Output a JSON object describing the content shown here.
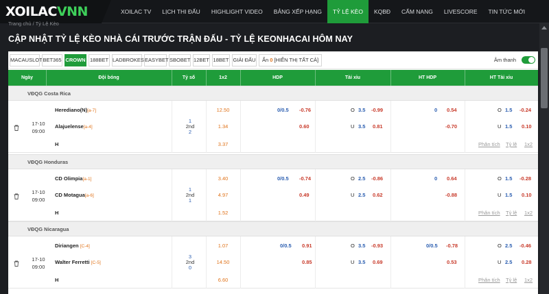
{
  "header": {
    "logo_white": "XOILAC",
    "logo_green": "VNN",
    "nav": [
      "XOILAC TV",
      "LỊCH THI ĐẤU",
      "HIGHLIGHT VIDEO",
      "BẢNG XẾP HẠNG",
      "TỶ LỆ KÈO",
      "KQBĐ",
      "CẨM NANG",
      "LIVESCORE",
      "TIN TỨC MỚI"
    ],
    "active_nav": "TỶ LỆ KÈO"
  },
  "breadcrumb": "Trang chủ / Tỷ Lệ Kèo",
  "page_title": "CẬP NHẬT TỶ LỆ KÈO NHÀ CÁI TRƯỚC TRẬN ĐẤU - TỶ LỆ KEONHACAI HÔM NAY",
  "bookmakers": [
    "MACAUSLOT",
    "BET365",
    "CROWN",
    "188BET",
    "LADBROKES",
    "EASYBET",
    "SBOBET",
    "12BET",
    "18BET",
    "GIẢI ĐẤU"
  ],
  "active_bookmaker": "CROWN",
  "hidden_prefix": "Ẩn",
  "hidden_count": "0",
  "show_all": "[HIỂN THỊ TẤT CẢ]",
  "sound_label": "Âm thanh",
  "columns": [
    "Ngày",
    "Đội bóng",
    "Tỷ số",
    "1x2",
    "HDP",
    "Tài xỉu",
    "HT HDP",
    "HT Tài xỉu"
  ],
  "links": [
    "Phân tích",
    "Tỷ lệ",
    "1x2"
  ],
  "leagues": [
    {
      "name": "VĐQG Costa Rica",
      "date": "17-10",
      "time": "09:00",
      "home": "Herediano(N)",
      "home_rank": "[a-7]",
      "away": "Alajuelense",
      "away_rank": "[a-4]",
      "draw": "H",
      "score_home": "1",
      "score_period": "2nd",
      "score_away": "2",
      "x12": [
        "12.50",
        "1.34",
        "3.37"
      ],
      "hdp_line": "0/0.5",
      "hdp_home": "-0.76",
      "hdp_away": "0.60",
      "ou_over": "O",
      "ou_line": "3.5",
      "ou_over_odds": "-0.99",
      "ou_under": "U",
      "ou_line_u": "3.5",
      "ou_under_odds": "0.81",
      "hthdp_line": "0",
      "hthdp_home": "0.54",
      "hthdp_away": "-0.70",
      "htou_over": "O",
      "htou_line": "1.5",
      "htou_over_odds": "-0.24",
      "htou_under": "U",
      "htou_line_u": "1.5",
      "htou_under_odds": "0.10"
    },
    {
      "name": "VĐQG Honduras",
      "date": "17-10",
      "time": "09:00",
      "home": "CD Olimpia",
      "home_rank": "[a-1]",
      "away": "CD Motagua",
      "away_rank": "[a-6]",
      "draw": "H",
      "score_home": "1",
      "score_period": "2nd",
      "score_away": "1",
      "x12": [
        "3.40",
        "4.97",
        "1.52"
      ],
      "hdp_line": "0/0.5",
      "hdp_home": "-0.74",
      "hdp_away": "0.49",
      "ou_over": "O",
      "ou_line": "2.5",
      "ou_over_odds": "-0.86",
      "ou_under": "U",
      "ou_line_u": "2.5",
      "ou_under_odds": "0.62",
      "hthdp_line": "0",
      "hthdp_home": "0.64",
      "hthdp_away": "-0.88",
      "htou_over": "O",
      "htou_line": "1.5",
      "htou_over_odds": "-0.28",
      "htou_under": "U",
      "htou_line_u": "1.5",
      "htou_under_odds": "0.10"
    },
    {
      "name": "VĐQG Nicaragua",
      "date": "17-10",
      "time": "09:00",
      "home": "Diriangen",
      "home_rank": "[C-4]",
      "away": "Walter Ferretti",
      "away_rank": "[C-5]",
      "draw": "H",
      "score_home": "3",
      "score_period": "2nd",
      "score_away": "0",
      "x12": [
        "1.07",
        "14.50",
        "6.60"
      ],
      "hdp_line": "0/0.5",
      "hdp_home": "0.91",
      "hdp_away": "0.85",
      "ou_over": "O",
      "ou_line": "3.5",
      "ou_over_odds": "-0.93",
      "ou_under": "U",
      "ou_line_u": "3.5",
      "ou_under_odds": "0.69",
      "hthdp_line": "0/0.5",
      "hthdp_home": "-0.78",
      "hthdp_away": "0.53",
      "htou_over": "O",
      "htou_line": "2.5",
      "htou_over_odds": "-0.46",
      "htou_under": "U",
      "htou_line_u": "2.5",
      "htou_under_odds": "0.28"
    }
  ],
  "colors": {
    "accent": "#1f9c3a",
    "odds_blue": "#2a5db0",
    "odds_red": "#c83a2a",
    "rank_orange": "#e0731a"
  }
}
